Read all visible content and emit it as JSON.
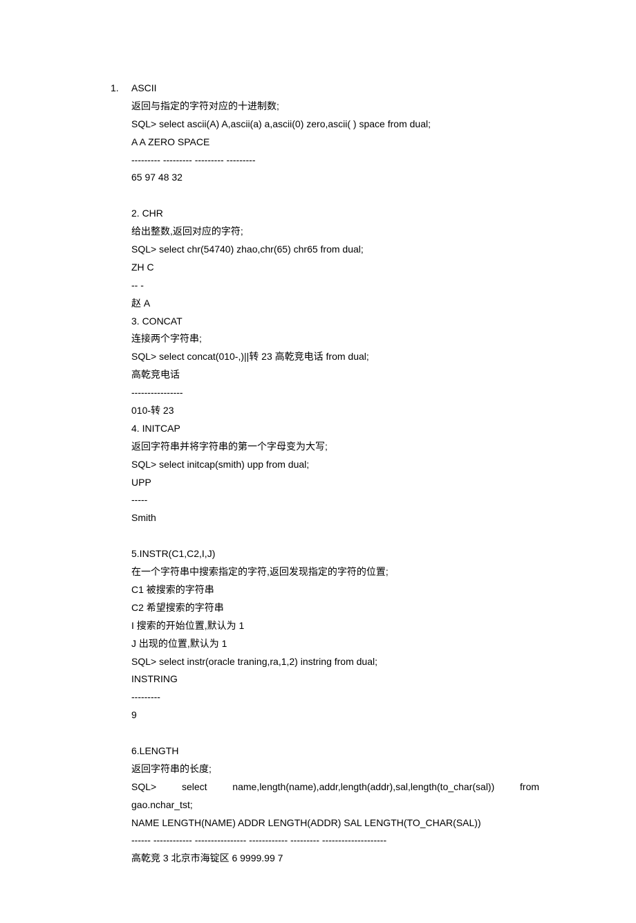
{
  "sections": {
    "s1": {
      "num": "1.",
      "title": "ASCII",
      "desc": "返回与指定的字符对应的十进制数;",
      "sql": "SQL> select ascii(A) A,ascii(a) a,ascii(0) zero,ascii( ) space from dual;",
      "header": "A A ZERO SPACE",
      "sep": "--------- --------- --------- ---------",
      "result": "65 97 48 32"
    },
    "s2": {
      "title": "2. CHR",
      "desc": "给出整数,返回对应的字符;",
      "sql": "SQL> select chr(54740) zhao,chr(65) chr65 from dual;",
      "header": "ZH C",
      "sep": "-- -",
      "result": "赵 A"
    },
    "s3": {
      "title": "3. CONCAT",
      "desc": "连接两个字符串;",
      "sql": "SQL> select concat(010-,)||转 23 高乾竞电话 from dual;",
      "header": "高乾竞电话",
      "sep": "----------------",
      "result": "010-转 23"
    },
    "s4": {
      "title": "4. INITCAP",
      "desc": "返回字符串并将字符串的第一个字母变为大写;",
      "sql": "SQL> select initcap(smith) upp from dual;",
      "header": "UPP",
      "sep": "-----",
      "result": "Smith"
    },
    "s5": {
      "title": "5.INSTR(C1,C2,I,J)",
      "desc": "在一个字符串中搜索指定的字符,返回发现指定的字符的位置;",
      "p1": "C1 被搜索的字符串",
      "p2": "C2 希望搜索的字符串",
      "p3": "I 搜索的开始位置,默认为 1",
      "p4": "J 出现的位置,默认为 1",
      "sql": "SQL> select instr(oracle traning,ra,1,2) instring from dual;",
      "header": "INSTRING",
      "sep": "---------",
      "result": "9"
    },
    "s6": {
      "title": "6.LENGTH",
      "desc": "返回字符串的长度;",
      "sql1a": "SQL>",
      "sql1b": "select",
      "sql1c": "name,length(name),addr,length(addr),sal,length(to_char(sal))",
      "sql1d": "from",
      "sql2": "gao.nchar_tst;",
      "header": "NAME LENGTH(NAME) ADDR LENGTH(ADDR) SAL LENGTH(TO_CHAR(SAL))",
      "sep": "------ ------------ ---------------- ------------ --------- --------------------",
      "result": "高乾竞 3 北京市海锭区 6 9999.99 7"
    }
  }
}
